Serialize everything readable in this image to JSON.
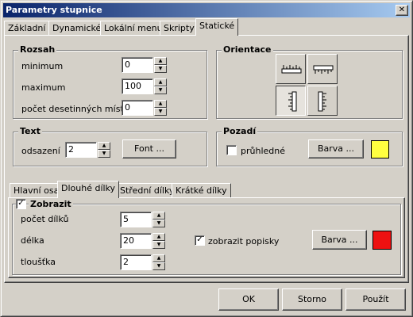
{
  "window": {
    "title": "Parametry stupnice",
    "close_glyph": "✕"
  },
  "tabs": [
    "Základní",
    "Dynamické",
    "Lokální menu",
    "Skripty",
    "Statické"
  ],
  "rozsah": {
    "title": "Rozsah",
    "minimum_label": "minimum",
    "minimum_value": "0",
    "maximum_label": "maximum",
    "maximum_value": "100",
    "decimals_label": "počet desetinných míst",
    "decimals_value": "0"
  },
  "orientace": {
    "title": "Orientace",
    "icons": [
      "ruler-horizontal-bottom-icon",
      "ruler-horizontal-top-icon",
      "ruler-vertical-left-icon",
      "ruler-vertical-right-icon"
    ]
  },
  "text_group": {
    "title": "Text",
    "offset_label": "odsazení",
    "offset_value": "2",
    "font_button": "Font ..."
  },
  "pozadi": {
    "title": "Pozadí",
    "transparent_label": "průhledné",
    "transparent_checked": false,
    "color_button": "Barva ...",
    "color": "#ffff40"
  },
  "subtabs": [
    "Hlavní osa",
    "Dlouhé dílky",
    "Střední dílky",
    "Krátké dílky"
  ],
  "dlouhe": {
    "show_label": "Zobrazit",
    "show_checked": true,
    "count_label": "počet dílků",
    "count_value": "5",
    "length_label": "délka",
    "length_value": "20",
    "thickness_label": "tloušťka",
    "thickness_value": "2",
    "labels_label": "zobrazit popisky",
    "labels_checked": true,
    "color_button": "Barva ...",
    "color": "#ee1111"
  },
  "footer": {
    "ok": "OK",
    "cancel": "Storno",
    "apply": "Použít"
  },
  "glyphs": {
    "check": "✓",
    "up": "▲",
    "down": "▼"
  }
}
